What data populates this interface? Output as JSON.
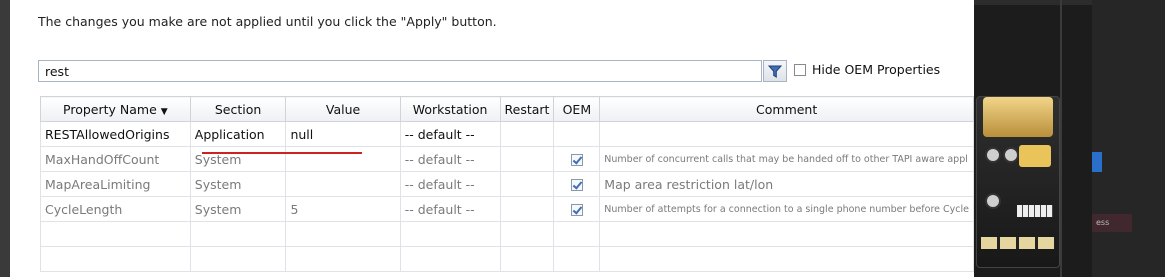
{
  "note": "The changes you make are not applied until you click the \"Apply\" button.",
  "search": {
    "value": "rest"
  },
  "filter_icon": "funnel-icon",
  "hide_oem_label": "Hide OEM Properties",
  "columns": [
    "Property Name",
    "Section",
    "Value",
    "Workstation",
    "Restart",
    "OEM",
    "Comment"
  ],
  "rows": [
    {
      "name": "RESTAllowedOrigins",
      "section": "Application",
      "value": "null",
      "workstation": "-- default --",
      "restart": "",
      "oem": false,
      "comment": ""
    },
    {
      "name": "MaxHandOffCount",
      "section": "System",
      "value": "",
      "workstation": "-- default --",
      "restart": "",
      "oem": true,
      "comment": "Number of concurrent calls that may be handed off to other TAPI aware appl"
    },
    {
      "name": "MapAreaLimiting",
      "section": "System",
      "value": "",
      "workstation": "-- default --",
      "restart": "",
      "oem": true,
      "comment": "Map area restriction lat/lon"
    },
    {
      "name": "CycleLength",
      "section": "System",
      "value": "5",
      "workstation": "-- default --",
      "restart": "",
      "oem": true,
      "comment": "Number of attempts for a connection to a single phone number before Cycle"
    }
  ],
  "right_panel": {
    "label": "ess"
  }
}
